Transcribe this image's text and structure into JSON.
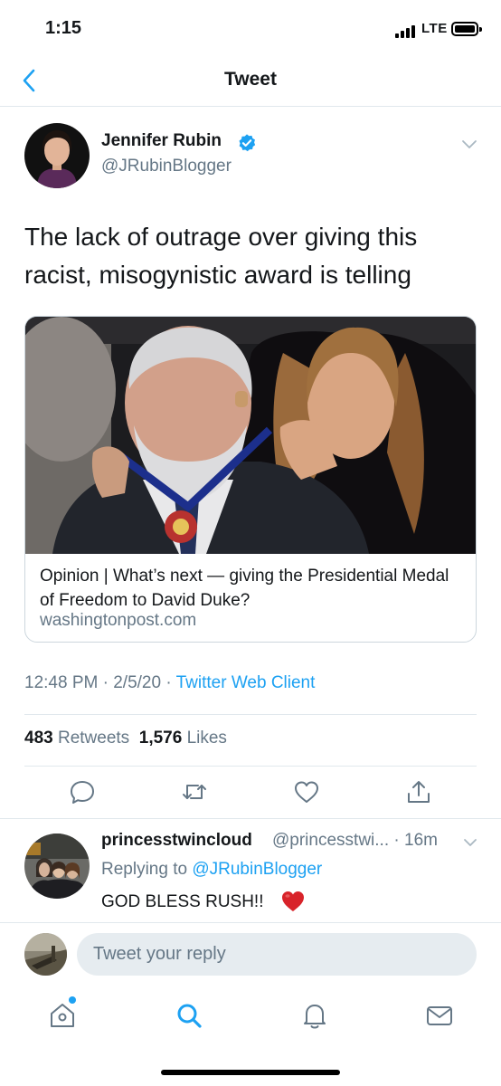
{
  "status_bar": {
    "time": "1:15",
    "network": "LTE"
  },
  "header": {
    "title": "Tweet"
  },
  "tweet": {
    "author_name": "Jennifer Rubin",
    "author_handle": "@JRubinBlogger",
    "text": "The lack of outrage over giving this racist, misogynistic award is telling",
    "card": {
      "title": "Opinion | What’s next — giving the Presidential Medal of Freedom to David Duke?",
      "domain": "washingtonpost.com"
    },
    "time": "12:48 PM",
    "date": "2/5/20",
    "client": "Twitter Web Client",
    "retweets_count": "483",
    "retweets_label": "Retweets",
    "likes_count": "1,576",
    "likes_label": "Likes"
  },
  "reply": {
    "name": "princesstwincloud",
    "handle": "@princesstwi...",
    "age": "16m",
    "replying_prefix": "Replying to",
    "replying_to": "@JRubinBlogger",
    "text": "GOD BLESS RUSH!!"
  },
  "compose": {
    "placeholder": "Tweet your reply"
  },
  "colors": {
    "accent": "#1da1f2",
    "secondary_text": "#657786",
    "border": "#e1e8ed",
    "heart": "#e0245e"
  },
  "icons": {
    "actions": [
      "reply-icon",
      "retweet-icon",
      "like-icon",
      "share-icon"
    ],
    "tabs": [
      "home-icon",
      "search-icon",
      "notifications-icon",
      "messages-icon"
    ]
  }
}
